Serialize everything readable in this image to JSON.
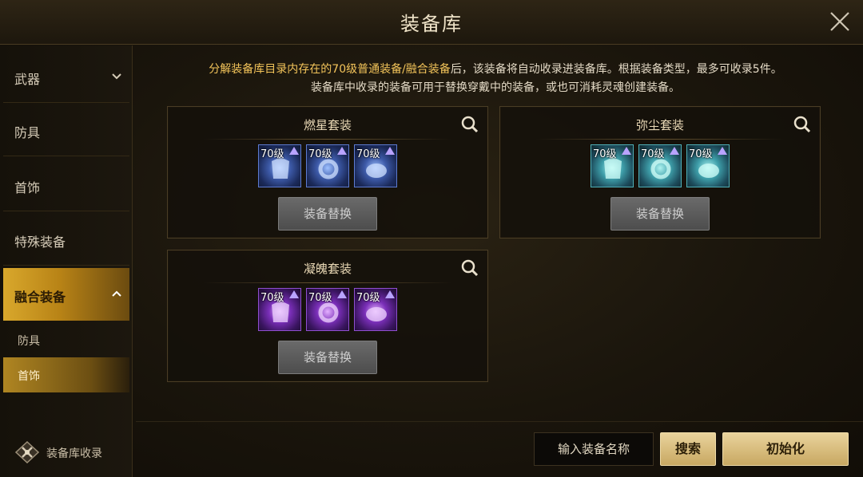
{
  "header": {
    "title": "装备库"
  },
  "sidebar": {
    "items": [
      {
        "label": "武器"
      },
      {
        "label": "防具"
      },
      {
        "label": "首饰"
      },
      {
        "label": "特殊装备"
      },
      {
        "label": "融合装备"
      }
    ],
    "subitems": [
      {
        "label": "防具"
      },
      {
        "label": "首饰"
      }
    ],
    "collect_label": "装备库收录"
  },
  "info": {
    "line1_part1": "分解装备库目录内存在的70级普通装备/融合装备",
    "line1_part2": "后，该装备将自动收录进装备库。根据装备类型，最多可收录5件。",
    "line2": "装备库中收录的装备可用于替换穿戴中的装备，或也可消耗灵魂创建装备。"
  },
  "cards": [
    {
      "title": "燃星套装",
      "button": "装备替换",
      "rarity_color": "#5d7bd1",
      "items": [
        {
          "level": "70级",
          "icon": "armor-icon"
        },
        {
          "level": "70级",
          "icon": "ring-icon"
        },
        {
          "level": "70级",
          "icon": "bracelet-icon"
        }
      ]
    },
    {
      "title": "弥尘套装",
      "button": "装备替换",
      "rarity_color": "#4fb0b8",
      "items": [
        {
          "level": "70级",
          "icon": "armor-icon"
        },
        {
          "level": "70级",
          "icon": "ring-icon"
        },
        {
          "level": "70级",
          "icon": "bracelet-icon"
        }
      ]
    },
    {
      "title": "凝魄套装",
      "button": "装备替换",
      "rarity_color": "#8f4fd0",
      "items": [
        {
          "level": "70级",
          "icon": "armor-icon"
        },
        {
          "level": "70级",
          "icon": "ring-icon"
        },
        {
          "level": "70级",
          "icon": "bracelet-icon"
        }
      ]
    }
  ],
  "bottom": {
    "search_placeholder": "输入装备名称",
    "search_button": "搜索",
    "reset_button": "初始化"
  },
  "colors": {
    "accent_gold": "#d9a82c",
    "highlight_text": "#f3c45a"
  }
}
